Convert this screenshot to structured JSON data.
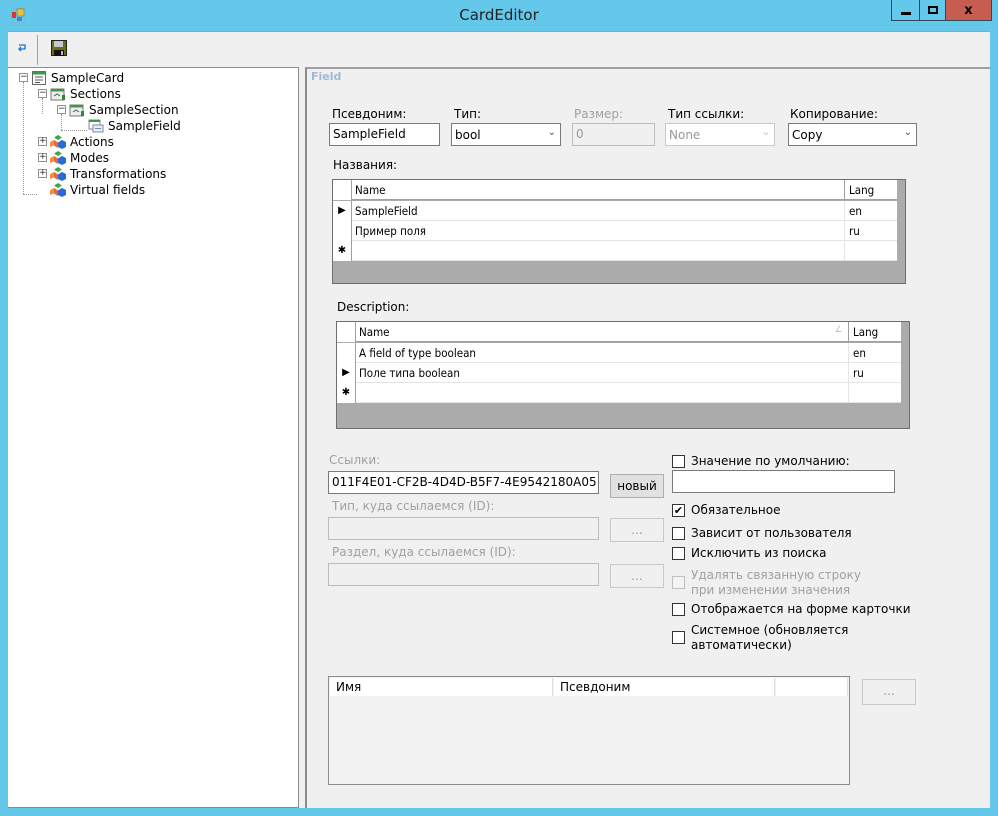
{
  "window": {
    "title": "CardEditor",
    "controls": [
      "minimize",
      "maximize",
      "close"
    ]
  },
  "toolbar": {
    "buttons": [
      {
        "name": "refresh-button",
        "icon": "return-arrow-icon"
      },
      {
        "name": "save-button",
        "icon": "floppy-disk-icon"
      }
    ]
  },
  "tree": {
    "nodes": [
      {
        "label": "SampleCard",
        "icon": "card-icon",
        "level": 0,
        "expanded": true
      },
      {
        "label": "Sections",
        "icon": "sections-icon",
        "level": 1,
        "expanded": true
      },
      {
        "label": "SampleSection",
        "icon": "section-icon",
        "level": 2,
        "expanded": true
      },
      {
        "label": "SampleField",
        "icon": "field-icon",
        "level": 3,
        "selected": false
      },
      {
        "label": "Actions",
        "icon": "cubes-icon",
        "level": 1,
        "expanded": false
      },
      {
        "label": "Modes",
        "icon": "cubes-icon",
        "level": 1,
        "expanded": false
      },
      {
        "label": "Transformations",
        "icon": "cubes-icon",
        "level": 1,
        "expanded": false
      },
      {
        "label": "Virtual fields",
        "icon": "cubes-icon",
        "level": 1
      }
    ]
  },
  "panel": {
    "title": "Field",
    "alias": {
      "label": "Псевдоним:",
      "value": "SampleField"
    },
    "type": {
      "label": "Тип:",
      "value": "bool"
    },
    "size": {
      "label": "Размер:",
      "value": "0",
      "disabled": true
    },
    "link_type": {
      "label": "Тип ссылки:",
      "value": "None",
      "disabled": true
    },
    "copy": {
      "label": "Копирование:",
      "value": "Copy"
    },
    "names": {
      "label": "Названия:",
      "columns": [
        "Name",
        "Lang"
      ],
      "rows": [
        {
          "name": "SampleField",
          "lang": "en",
          "current": true
        },
        {
          "name": "Пример поля",
          "lang": "ru",
          "current": false
        }
      ],
      "new_row_marker": "✱"
    },
    "description": {
      "label": "Description:",
      "columns": [
        "Name",
        "Lang"
      ],
      "rows": [
        {
          "name": "A field of type boolean",
          "lang": "en",
          "current": false
        },
        {
          "name": "Поле типа boolean",
          "lang": "ru",
          "current": true
        }
      ],
      "new_row_marker": "✱"
    },
    "links": {
      "label": "Ссылки:",
      "value": "011F4E01-CF2B-4D4D-B5F7-4E9542180A05",
      "new_button": "новый",
      "ref_type_label": "Тип, куда ссылаемся (ID):",
      "ref_type_value": "",
      "ref_section_label": "Раздел, куда ссылаемся (ID):",
      "ref_section_value": "",
      "browse_label": "..."
    },
    "default_value": {
      "label": "Значение по умолчанию:",
      "checked": false,
      "value": ""
    },
    "checkboxes": [
      {
        "label": "Обязательное",
        "checked": true,
        "disabled": false
      },
      {
        "label": "Зависит от пользователя",
        "checked": false,
        "disabled": false
      },
      {
        "label": "Исключить из поиска",
        "checked": false,
        "disabled": false
      },
      {
        "label": "Удалять связанную строку при изменении значения",
        "checked": false,
        "disabled": true
      },
      {
        "label": "Отображается на форме карточки",
        "checked": false,
        "disabled": false
      },
      {
        "label": "Системное (обновляется автоматически)",
        "checked": false,
        "disabled": false
      }
    ],
    "bottom_list": {
      "columns": [
        "Имя",
        "Псевдоним",
        ""
      ],
      "browse_label": "..."
    }
  }
}
